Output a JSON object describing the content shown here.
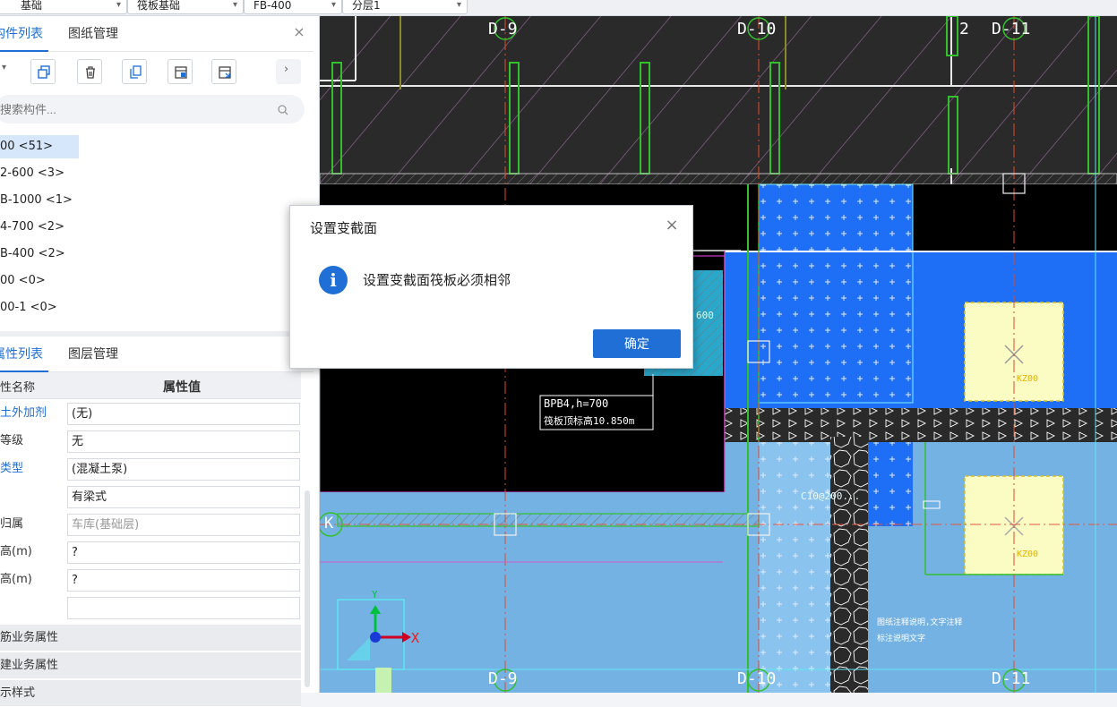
{
  "toolbar": {
    "selects": [
      {
        "label": "基础"
      },
      {
        "label": "筏板基础"
      },
      {
        "label": "FB-400"
      },
      {
        "label": "分层1"
      }
    ]
  },
  "top_panel": {
    "tabs": [
      "构件列表",
      "图纸管理"
    ],
    "close_label": "×",
    "more_label": "›",
    "search_placeholder": "搜索构件...",
    "items": [
      {
        "label": "00 <51>",
        "selected": true
      },
      {
        "label": "2-600 <3>"
      },
      {
        "label": "B-1000 <1>"
      },
      {
        "label": "4-700 <2>"
      },
      {
        "label": "B-400 <2>"
      },
      {
        "label": "00 <0>"
      },
      {
        "label": "00-1 <0>"
      }
    ]
  },
  "bottom_panel": {
    "tabs": [
      "属性列表",
      "图层管理"
    ],
    "header_name": "性名称",
    "header_value": "属性值",
    "rows": [
      {
        "name": "土外加剂",
        "value": "(无)",
        "blue": true
      },
      {
        "name": "等级",
        "value": "无"
      },
      {
        "name": "类型",
        "value": "(混凝土泵)",
        "blue": true
      },
      {
        "name": "",
        "value": "有梁式"
      },
      {
        "name": "归属",
        "value": "车库(基础层)",
        "grey": true
      },
      {
        "name": "高(m)",
        "value": "?"
      },
      {
        "name": "高(m)",
        "value": "?"
      },
      {
        "name": "",
        "value": ""
      }
    ],
    "groups": [
      "筋业务属性",
      "建业务属性",
      "示样式"
    ]
  },
  "cad": {
    "axis_labels_top": [
      "D-9",
      "D-10",
      "2",
      "D-11"
    ],
    "axis_labels_bottom": [
      "D-9",
      "D-10",
      "D-11"
    ],
    "row_label": "K",
    "annotation_line1": "BPB4,h=700",
    "annotation_line2": "筏板顶标高10.850m",
    "dim_600": "600",
    "rebar_label": "C10@200...",
    "col_label": "KZ00",
    "ucs_x": "X",
    "ucs_y": "Y",
    "note_line1": "图纸注释说明,文字注释",
    "note_line2": "标注说明文字"
  },
  "dialog": {
    "title": "设置变截面",
    "close_label": "×",
    "message": "设置变截面筏板必须相邻",
    "ok_label": "确定",
    "info_glyph": "i"
  },
  "colors": {
    "accent": "#1f6fd6",
    "cad_bg": "#000000",
    "raft_light": "#74b2e3",
    "raft_bright": "#1e6ff5",
    "column_fill": "#fbfbc4",
    "wall_green": "#34c02e"
  }
}
